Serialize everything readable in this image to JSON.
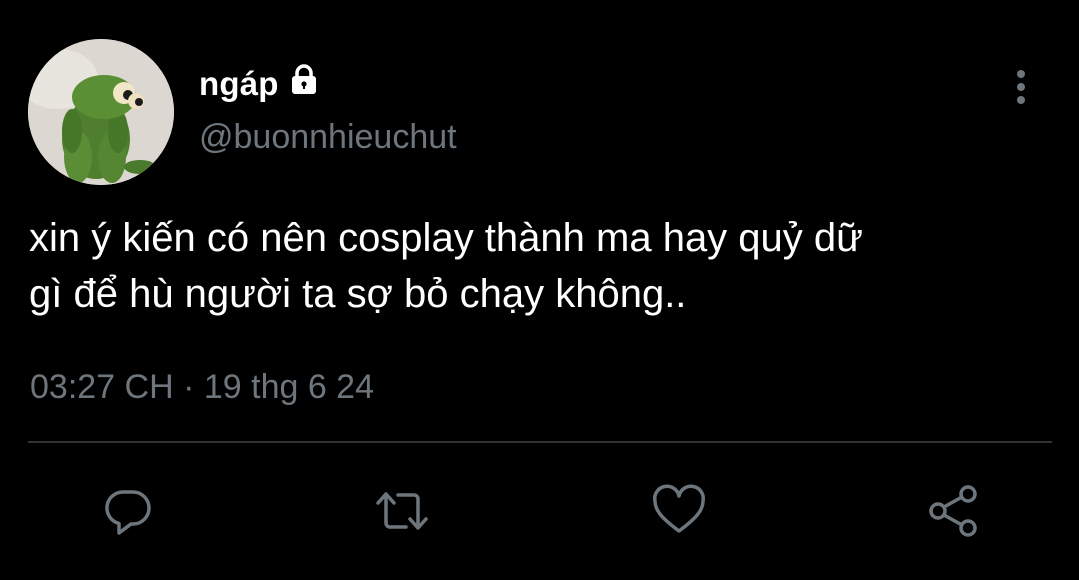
{
  "tweet": {
    "author": {
      "display_name": "ngáp",
      "handle": "@buonnhieuchut",
      "protected_icon": "lock-icon",
      "avatar": "frog-plush-avatar"
    },
    "text": "xin ý kiến có nên cosplay thành ma hay quỷ dữ\ngì để hù người ta sợ bỏ chạy không..",
    "timestamp": "03:27 CH · 19 thg 6 24"
  },
  "menu_icon": "more-vertical-icon",
  "actions": [
    {
      "name": "reply",
      "icon": "reply-icon"
    },
    {
      "name": "retweet",
      "icon": "retweet-icon"
    },
    {
      "name": "like",
      "icon": "heart-icon"
    },
    {
      "name": "share",
      "icon": "share-icon"
    }
  ],
  "colors": {
    "background": "#000000",
    "text_primary": "#ffffff",
    "text_secondary": "#6e767d",
    "divider": "#2f3336"
  }
}
